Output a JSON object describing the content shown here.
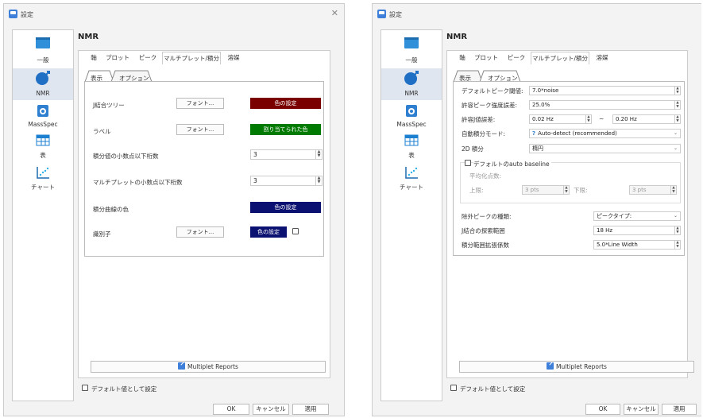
{
  "window": {
    "title": "設定"
  },
  "sidebar": [
    {
      "label": "一般",
      "icon": "window-icon"
    },
    {
      "label": "NMR",
      "icon": "nmr-icon"
    },
    {
      "label": "MassSpec",
      "icon": "massspec-icon"
    },
    {
      "label": "表",
      "icon": "table-icon"
    },
    {
      "label": "チャート",
      "icon": "chart-icon"
    }
  ],
  "heading": "NMR",
  "tabs": [
    "軸",
    "プロット",
    "ピーク",
    "マルチプレット/積分",
    "溶媒"
  ],
  "subtabs": [
    "表示",
    "オプション"
  ],
  "display": {
    "row1_label": "J結合ツリー",
    "row1_font": "フォント...",
    "row1_color": "色の設定",
    "row2_label": "ラベル",
    "row2_font": "フォント...",
    "row2_color": "割り当てられた色",
    "row3_label": "積分値の小数点以下桁数",
    "row3_value": "3",
    "row4_label": "マルチプレットの小数点以下桁数",
    "row4_value": "3",
    "row5_label": "積分曲線の色",
    "row5_color": "色の設定",
    "row6_label": "識別子",
    "row6_font": "フォント...",
    "row6_color": "色の設定"
  },
  "colors": {
    "tree": "#7a0000",
    "label": "#007a00",
    "curve": "#0b1170",
    "ident": "#0b1170",
    "mr_icon": "#3d7fd9"
  },
  "options": {
    "peak_thresh_label": "デフォルトピーク閾値:",
    "peak_thresh_value": "7.0*noise",
    "intensity_label": "許容ピーク強度誤差:",
    "intensity_value": "25.0%",
    "jtol_label": "許容J値誤差:",
    "jtol_min": "0.02 Hz",
    "jtol_sep": "~",
    "jtol_max": "0.20 Hz",
    "auto_mode_label": "自動積分モード:",
    "auto_mode_value": "Auto-detect (recommended)",
    "int2d_label": "2D 積分",
    "int2d_value": "楕円",
    "baseline_label": "デフォルトのauto baseline",
    "avg_label": "平均化点数:",
    "upper_label": "上限:",
    "upper_value": "3 pts",
    "lower_label": "下限:",
    "lower_value": "3 pts",
    "exclude_label": "除外ピークの種類:",
    "exclude_value": "ピークタイプ:",
    "jsearch_label": "J結合の探索範囲",
    "jsearch_value": "18 Hz",
    "range_label": "積分範囲拡張係数",
    "range_value": "5.0*Line Width"
  },
  "multiplet_reports": "Multiplet Reports",
  "default_check": "デフォルト値として設定",
  "buttons": {
    "ok": "OK",
    "cancel": "キャンセル",
    "apply": "適用"
  }
}
